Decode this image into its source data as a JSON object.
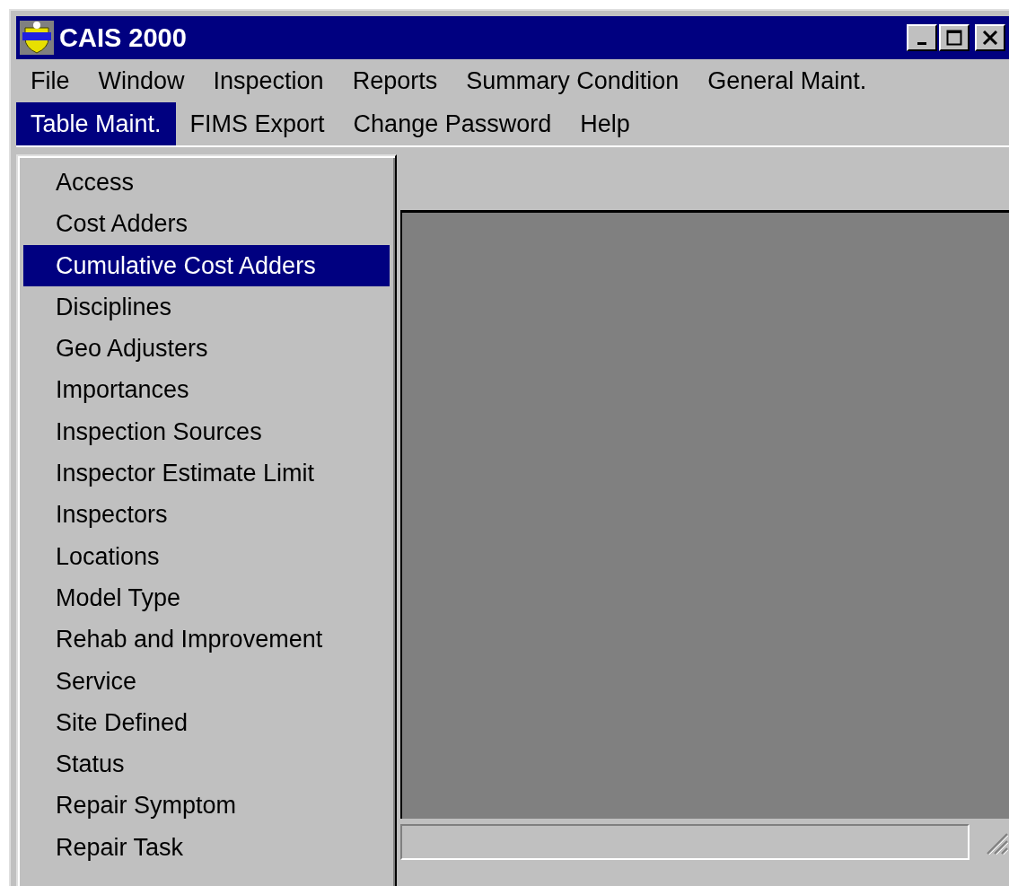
{
  "window": {
    "title": "CAIS 2000"
  },
  "menu_bar": [
    {
      "label": "File",
      "selected": false
    },
    {
      "label": "Window",
      "selected": false
    },
    {
      "label": "Inspection",
      "selected": false
    },
    {
      "label": "Reports",
      "selected": false
    },
    {
      "label": "Summary Condition",
      "selected": false
    },
    {
      "label": "General Maint.",
      "selected": false
    },
    {
      "label": "Table Maint.",
      "selected": true
    },
    {
      "label": "FIMS Export",
      "selected": false
    },
    {
      "label": "Change Password",
      "selected": false
    },
    {
      "label": "Help",
      "selected": false
    }
  ],
  "dropdown": {
    "items": [
      {
        "label": "Access",
        "selected": false
      },
      {
        "label": "Cost Adders",
        "selected": false
      },
      {
        "label": "Cumulative Cost Adders",
        "selected": true
      },
      {
        "label": "Disciplines",
        "selected": false
      },
      {
        "label": "Geo Adjusters",
        "selected": false
      },
      {
        "label": "Importances",
        "selected": false
      },
      {
        "label": "Inspection Sources",
        "selected": false
      },
      {
        "label": "Inspector Estimate Limit",
        "selected": false
      },
      {
        "label": "Inspectors",
        "selected": false
      },
      {
        "label": "Locations",
        "selected": false
      },
      {
        "label": "Model Type",
        "selected": false
      },
      {
        "label": "Rehab and Improvement",
        "selected": false
      },
      {
        "label": "Service",
        "selected": false
      },
      {
        "label": "Site Defined",
        "selected": false
      },
      {
        "label": "Status",
        "selected": false
      },
      {
        "label": "Repair Symptom",
        "selected": false
      },
      {
        "label": "Repair Task",
        "selected": false
      }
    ]
  }
}
